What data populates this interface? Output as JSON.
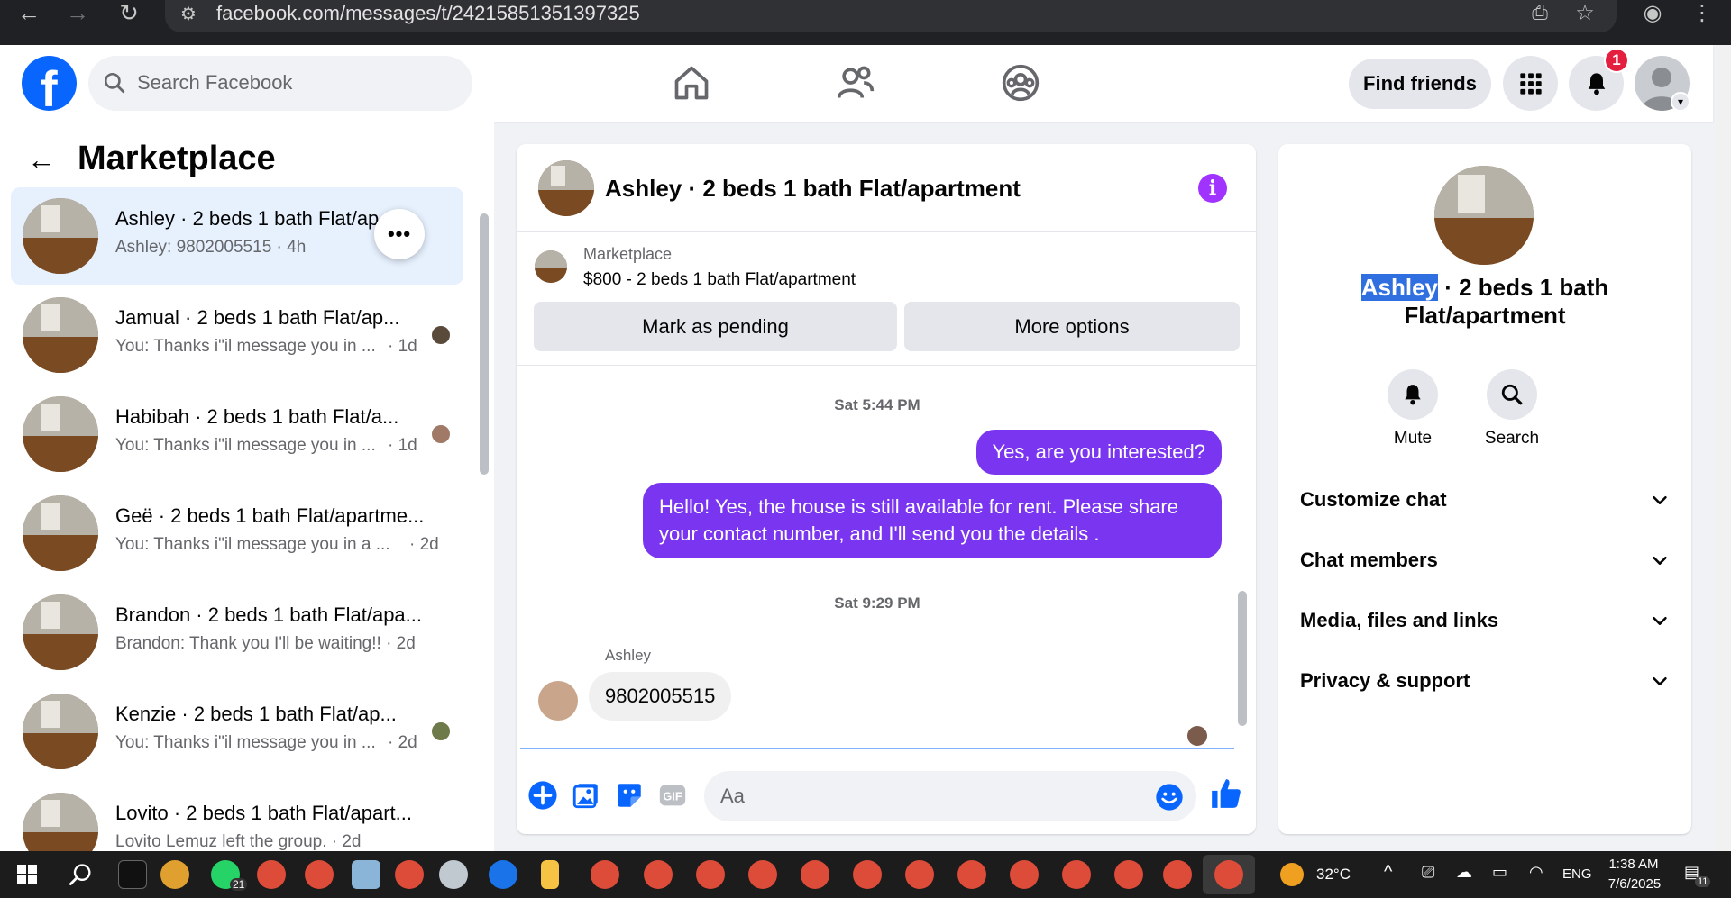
{
  "browser": {
    "url": "facebook.com/messages/t/24215851351397325"
  },
  "header": {
    "search_placeholder": "Search Facebook",
    "find_friends": "Find friends",
    "notification_count": "1"
  },
  "sidebar": {
    "title": "Marketplace",
    "conversations": [
      {
        "name": "Ashley · 2 beds 1 bath Flat/ap…",
        "preview": "Ashley: 9802005515 · 4h",
        "time": ""
      },
      {
        "name": "Jamual · 2 beds 1 bath Flat/ap...",
        "preview": "You: Thanks i\"il message you in ...",
        "time": "· 1d"
      },
      {
        "name": "Habibah · 2 beds 1 bath Flat/a...",
        "preview": "You: Thanks i\"il message you in ...",
        "time": "· 1d"
      },
      {
        "name": "Geë · 2 beds 1 bath Flat/apartme...",
        "preview": "You: Thanks i\"il message you in a ...",
        "time": "· 2d"
      },
      {
        "name": "Brandon · 2 beds 1 bath Flat/apa...",
        "preview": "Brandon: Thank you I'll be waiting!! · 2d",
        "time": ""
      },
      {
        "name": "Kenzie · 2 beds 1 bath Flat/ap...",
        "preview": "You: Thanks i\"il message you in ...",
        "time": "· 2d"
      },
      {
        "name": "Lovito · 2 beds 1 bath Flat/apart...",
        "preview": "Lovito Lemuz left the group. · 2d",
        "time": ""
      }
    ]
  },
  "chat": {
    "title": "Ashley · 2 beds 1 bath Flat/apartment",
    "marketplace_label": "Marketplace",
    "listing": "$800 - 2 beds 1 bath Flat/apartment",
    "mark_pending": "Mark as pending",
    "more_options": "More options",
    "ts1": "Sat 5:44 PM",
    "msg_out_1": "Yes, are you interested?",
    "msg_out_2": "Hello! Yes, the house is still available for rent. Please share your contact number, and I'll send you the details .",
    "ts2": "Sat 9:29 PM",
    "sender": "Ashley",
    "msg_in_1": "9802005515",
    "composer_placeholder": "Aa"
  },
  "right_panel": {
    "name_highlight": "Ashley",
    "name_rest": " · 2 beds 1 bath Flat/apartment",
    "mute": "Mute",
    "search": "Search",
    "rows": [
      "Customize chat",
      "Chat members",
      "Media, files and links",
      "Privacy & support"
    ]
  },
  "taskbar": {
    "whatsapp_badge": "21",
    "temperature": "32°C",
    "language": "ENG",
    "time": "1:38 AM",
    "date": "7/6/2025",
    "notif_count": "11"
  },
  "colors": {
    "fb_blue": "#0866ff",
    "messenger_purple": "#7a35f0",
    "info_purple": "#a033ff"
  }
}
